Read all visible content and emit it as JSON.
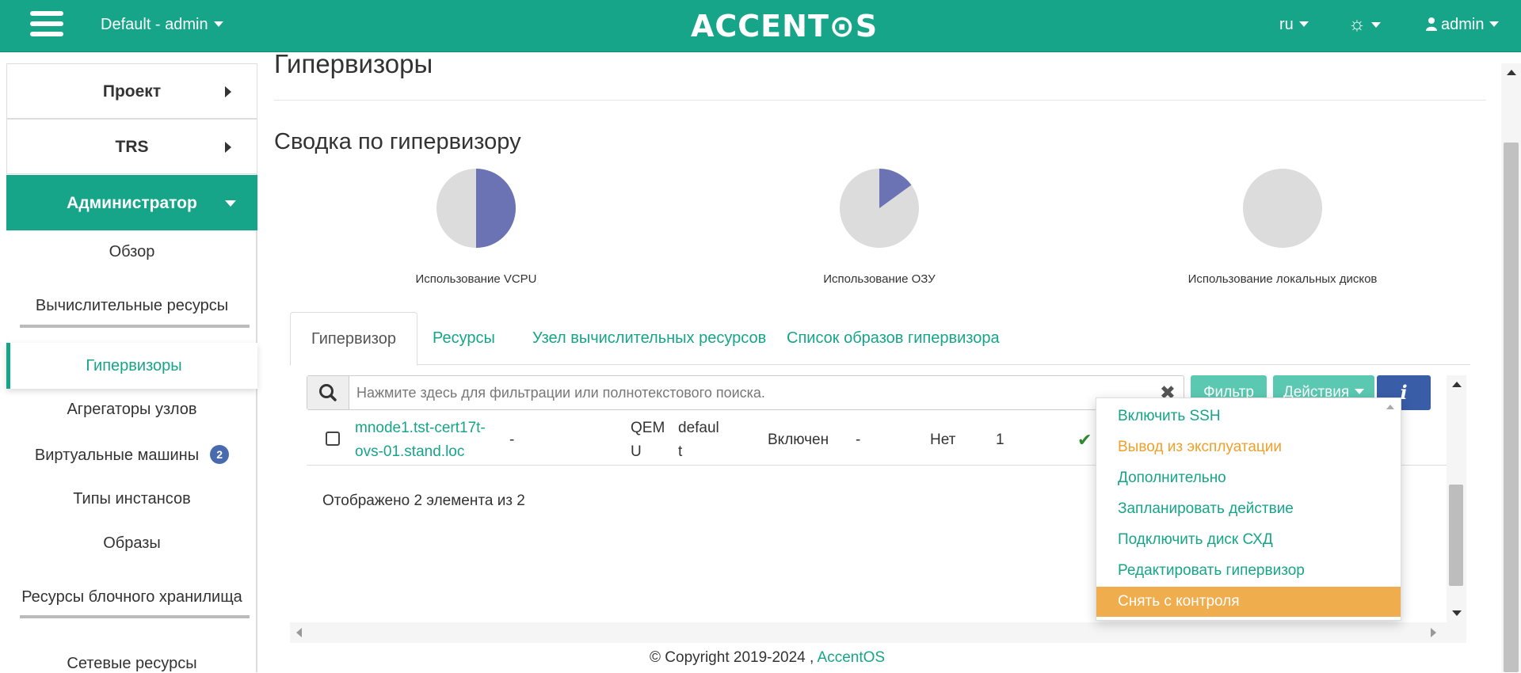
{
  "header": {
    "project_selector": "Default - admin",
    "logo": "ACCENT⊙S",
    "language": "ru",
    "theme_icon": "gear-icon",
    "user": "admin"
  },
  "sidebar": {
    "sections": [
      {
        "label": "Проект"
      },
      {
        "label": "TRS"
      },
      {
        "label": "Администратор"
      }
    ],
    "items": [
      {
        "label": "Обзор"
      },
      {
        "label": "Вычислительные ресурсы"
      },
      {
        "label": "Гипервизоры"
      },
      {
        "label": "Агрегаторы узлов"
      },
      {
        "label": "Виртуальные машины",
        "badge": "2"
      },
      {
        "label": "Типы инстансов"
      },
      {
        "label": "Образы"
      },
      {
        "label": "Ресурсы блочного хранилища"
      },
      {
        "label": "Сетевые ресурсы"
      }
    ]
  },
  "page": {
    "title": "Гипервизоры",
    "summary_title": "Сводка по гипервизору",
    "charts": [
      {
        "label": "Использование VCPU",
        "used_fraction": 0.5
      },
      {
        "label": "Использование ОЗУ",
        "used_fraction": 0.15
      },
      {
        "label": "Использование локальных дисков",
        "used_fraction": 0
      }
    ],
    "colors": {
      "accent": "#17a589",
      "pie_used": "#6b73b5",
      "pie_free": "#dcdcdc",
      "warning": "#f0ad4e"
    }
  },
  "tabs": [
    {
      "label": "Гипервизор"
    },
    {
      "label": "Ресурсы"
    },
    {
      "label": "Узел вычислительных ресурсов"
    },
    {
      "label": "Список образов гипервизора"
    }
  ],
  "table": {
    "search_placeholder": "Нажмите здесь для фильтрации или полнотекстового поиска.",
    "filter_button": "Фильтр",
    "actions_button": "Действия",
    "rows": [
      {
        "host_line1": "mnode1.tst-cert17t-",
        "host_line2": "ovs-01.stand.loc",
        "col2": "-",
        "type_line1": "QEM",
        "type_line2": "U",
        "zone_line1": "defaul",
        "zone_line2": "t",
        "status": "Включен",
        "col6": "-",
        "col7": "Нет",
        "col8": "1"
      }
    ],
    "count_text": "Отображено 2 элемента из 2"
  },
  "dropdown": {
    "items": [
      {
        "label": "Включить SSH",
        "style": "normal"
      },
      {
        "label": "Вывод из эксплуатации",
        "style": "warn"
      },
      {
        "label": "Дополнительно",
        "style": "normal"
      },
      {
        "label": "Запланировать действие",
        "style": "normal"
      },
      {
        "label": "Подключить диск СХД",
        "style": "normal"
      },
      {
        "label": "Редактировать гипервизор",
        "style": "normal"
      },
      {
        "label": "Снять с контроля",
        "style": "hl"
      }
    ]
  },
  "footer": {
    "copyright": "© Copyright 2019-2024 ,",
    "link": "AccentOS"
  }
}
